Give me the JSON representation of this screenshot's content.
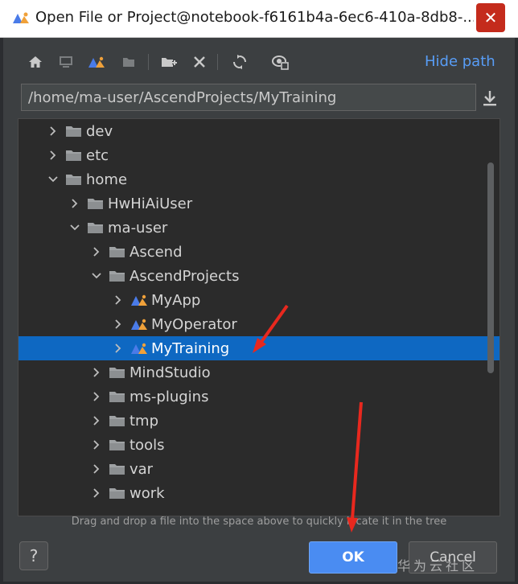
{
  "window": {
    "title": "Open File or Project@notebook-f6161b4a-6ec6-410a-8db8-...",
    "close_glyph": "✕"
  },
  "toolbar": {
    "icons": [
      "home-icon",
      "desktop-icon",
      "project-icon",
      "module-icon",
      "new-folder-icon",
      "delete-icon",
      "refresh-icon",
      "show-hidden-icon"
    ],
    "hide_path_label": "Hide path"
  },
  "path": {
    "value": "/home/ma-user/AscendProjects/MyTraining"
  },
  "tree": {
    "items": [
      {
        "label": "dev",
        "depth": 0,
        "expanded": false,
        "icon": "folder-icon"
      },
      {
        "label": "etc",
        "depth": 0,
        "expanded": false,
        "icon": "folder-icon"
      },
      {
        "label": "home",
        "depth": 0,
        "expanded": true,
        "icon": "folder-icon"
      },
      {
        "label": "HwHiAiUser",
        "depth": 1,
        "expanded": false,
        "icon": "folder-icon"
      },
      {
        "label": "ma-user",
        "depth": 1,
        "expanded": true,
        "icon": "folder-icon"
      },
      {
        "label": "Ascend",
        "depth": 2,
        "expanded": false,
        "icon": "folder-icon"
      },
      {
        "label": "AscendProjects",
        "depth": 2,
        "expanded": true,
        "icon": "folder-icon"
      },
      {
        "label": "MyApp",
        "depth": 3,
        "expanded": false,
        "icon": "project-icon"
      },
      {
        "label": "MyOperator",
        "depth": 3,
        "expanded": false,
        "icon": "project-icon"
      },
      {
        "label": "MyTraining",
        "depth": 3,
        "expanded": false,
        "icon": "project-icon",
        "selected": true
      },
      {
        "label": "MindStudio",
        "depth": 2,
        "expanded": false,
        "icon": "folder-icon"
      },
      {
        "label": "ms-plugins",
        "depth": 2,
        "expanded": false,
        "icon": "folder-icon"
      },
      {
        "label": "tmp",
        "depth": 2,
        "expanded": false,
        "icon": "folder-icon"
      },
      {
        "label": "tools",
        "depth": 2,
        "expanded": false,
        "icon": "folder-icon"
      },
      {
        "label": "var",
        "depth": 2,
        "expanded": false,
        "icon": "folder-icon"
      },
      {
        "label": "work",
        "depth": 2,
        "expanded": false,
        "icon": "folder-icon"
      }
    ]
  },
  "hint": "Drag and drop a file into the space above to quickly locate it in the tree",
  "buttons": {
    "help": "?",
    "ok": "OK",
    "cancel": "Cancel"
  },
  "watermark": "华为云社区",
  "colors": {
    "selection": "#0e68c2",
    "link": "#589df6",
    "ok": "#4a8cf2",
    "annotation_arrow": "#e8281e"
  }
}
